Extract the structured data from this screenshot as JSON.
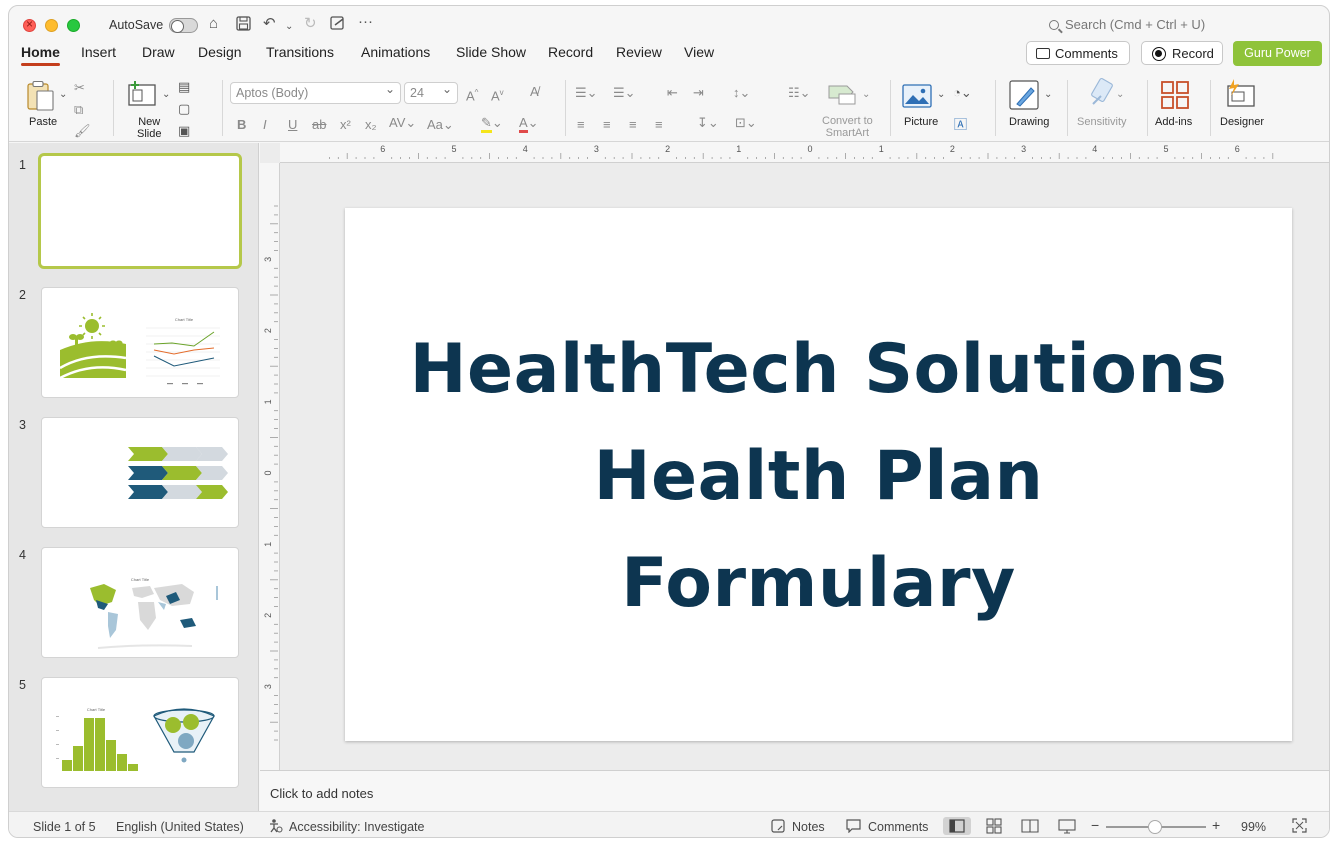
{
  "titlebar": {
    "autosave_label": "AutoSave",
    "search_placeholder": "Search (Cmd + Ctrl + U)"
  },
  "tabs": [
    "Home",
    "Insert",
    "Draw",
    "Design",
    "Transitions",
    "Animations",
    "Slide Show",
    "Record",
    "Review",
    "View"
  ],
  "header_buttons": {
    "comments": "Comments",
    "record": "Record",
    "guru": "Guru Power"
  },
  "ribbon": {
    "paste": "Paste",
    "new_slide_line1": "New",
    "new_slide_line2": "Slide",
    "font_name": "Aptos (Body)",
    "font_size": "24",
    "convert_line1": "Convert to",
    "convert_line2": "SmartArt",
    "picture": "Picture",
    "drawing": "Drawing",
    "sensitivity": "Sensitivity",
    "addins": "Add-ins",
    "designer": "Designer"
  },
  "thumbnails": [
    {
      "num": "1"
    },
    {
      "num": "2",
      "chart_title": "Chart Title"
    },
    {
      "num": "3"
    },
    {
      "num": "4",
      "chart_title": "Chart Title"
    },
    {
      "num": "5",
      "chart_title": "Chart Title"
    }
  ],
  "slide": {
    "title_lines": [
      "HealthTech Solutions",
      "Health Plan",
      "Formulary"
    ]
  },
  "notes_placeholder": "Click to add notes",
  "statusbar": {
    "slide_info": "Slide 1 of 5",
    "language": "English (United States)",
    "accessibility": "Accessibility: Investigate",
    "notes": "Notes",
    "comments": "Comments",
    "zoom": "99%"
  },
  "ruler": {
    "top_labels": [
      "6",
      "5",
      "4",
      "3",
      "2",
      "1",
      "0",
      "1",
      "2",
      "3",
      "4",
      "5",
      "6"
    ],
    "left_labels": [
      "3",
      "2",
      "1",
      "0",
      "1",
      "2",
      "3"
    ]
  },
  "colors": {
    "accent_tab": "#c43e1c",
    "guru_green": "#8fc33a",
    "title_navy": "#0d3550",
    "thumb_green": "#9bbd2e",
    "thumb_teal": "#1f5a7a"
  }
}
